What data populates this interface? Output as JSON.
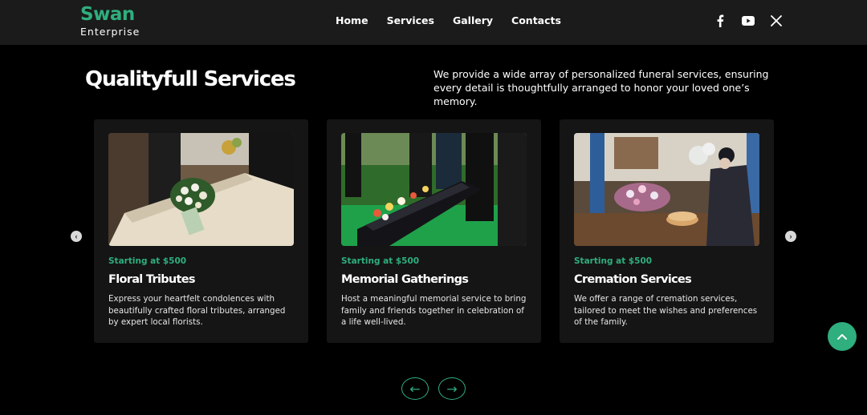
{
  "header": {
    "logo_title": "Swan",
    "logo_subtitle": "Enterprise",
    "nav": [
      "Home",
      "Services",
      "Gallery",
      "Contacts"
    ],
    "social_icons": [
      "facebook-icon",
      "youtube-icon",
      "x-icon"
    ]
  },
  "section": {
    "title": "Qualityfull Services",
    "intro": "We provide a wide array of personalized funeral services, ensuring every detail is thoughtfully arranged to honor your loved one’s memory."
  },
  "cards": [
    {
      "price": "Starting at $500",
      "name": "Floral Tributes",
      "description": "Express your heartfelt condolences with beautifully crafted floral tributes, arranged by expert local florists."
    },
    {
      "price": "Starting at $500",
      "name": "Memorial Gatherings",
      "description": "Host a meaningful memorial service to bring family and friends together in celebration of a life well-lived."
    },
    {
      "price": "Starting at $500",
      "name": "Cremation Services",
      "description": "We offer a range of cremation services, tailored to meet the wishes and preferences of the family."
    }
  ],
  "controls": {
    "prev_arrow": "←",
    "next_arrow": "→",
    "slider_prev": "‹",
    "slider_next": "›"
  },
  "colors": {
    "accent": "#2fae7e",
    "header_bg": "#1b1b1b",
    "card_bg": "#151515",
    "page_bg": "#000000"
  }
}
